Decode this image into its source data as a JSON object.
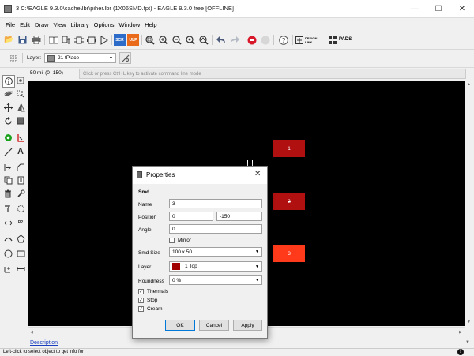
{
  "window": {
    "title": "3 C:\\EAGLE 9.3.0\\cache\\lbr\\piher.lbr (1X06SMD.fpt) - EAGLE 9.3.0 free [OFFLINE]",
    "controls": {
      "minimize": "—",
      "maximize": "☐",
      "close": "✕"
    }
  },
  "menu": [
    "File",
    "Edit",
    "Draw",
    "View",
    "Library",
    "Options",
    "Window",
    "Help"
  ],
  "toolbar": {
    "scr_label": "SCR",
    "ulp_label": "ULP",
    "design_link_label": "DESIGN LINK",
    "pads_label": "PADS"
  },
  "layerbar": {
    "layer_label": "Layer:",
    "layer_value": "21 tPlace",
    "layer_color": "#8a8a8a"
  },
  "cmdline": {
    "coordinate": "50 mil (0 -150)",
    "placeholder": "Click or press Ctrl+L key to activate command line mode"
  },
  "canvas": {
    "background": "#000000",
    "pads": [
      {
        "label": "1",
        "color": "#b01010"
      },
      {
        "label": "2",
        "color": "#b01010"
      },
      {
        "label": "3",
        "color": "#ff3a1a"
      }
    ]
  },
  "dialog": {
    "title": "Properties",
    "section": "Smd",
    "name_label": "Name",
    "name_value": "3",
    "position_label": "Position",
    "position_x": "0",
    "position_y": "-150",
    "angle_label": "Angle",
    "angle_value": "0",
    "mirror_label": "Mirror",
    "mirror_checked": false,
    "smd_size_label": "Smd Size",
    "smd_size_value": "100 x 50",
    "layer_label": "Layer",
    "layer_value": "1 Top",
    "layer_color": "#a00000",
    "roundness_label": "Roundness",
    "roundness_value": "0 %",
    "thermals_label": "Thermals",
    "stop_label": "Stop",
    "cream_label": "Cream",
    "ok_label": "OK",
    "cancel_label": "Cancel",
    "apply_label": "Apply"
  },
  "description_link": "Description",
  "status": "Left-click to select object to get info for"
}
